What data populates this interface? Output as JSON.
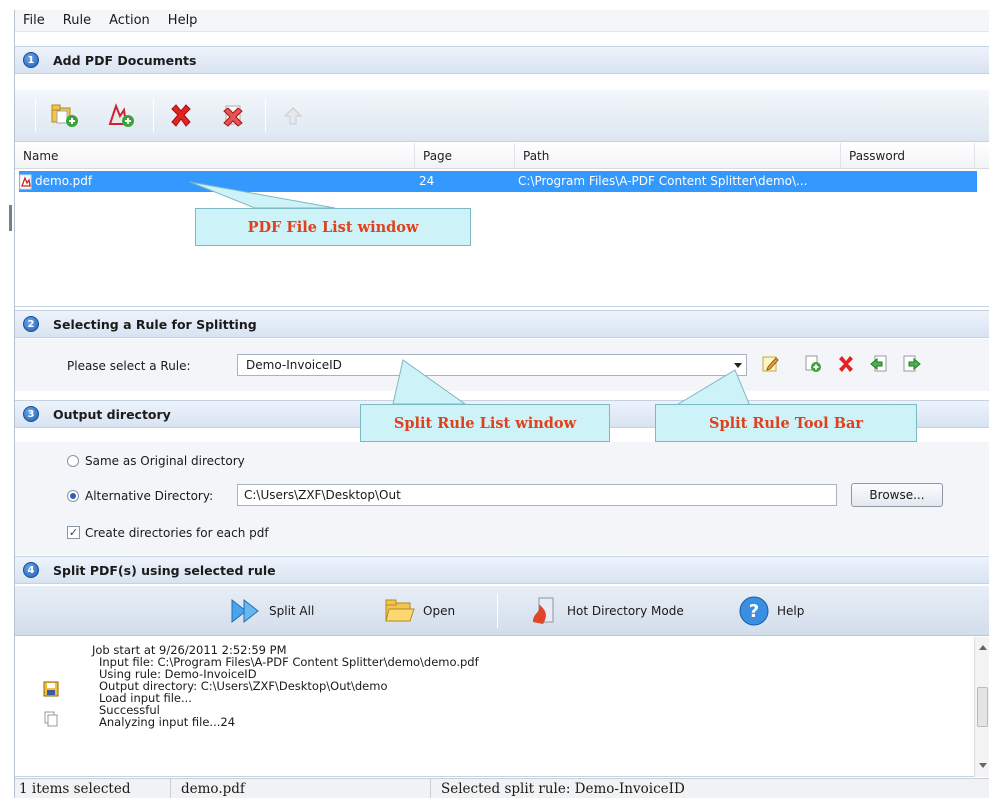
{
  "menu": [
    "File",
    "Rule",
    "Action",
    "Help"
  ],
  "sections": [
    {
      "num": "1",
      "title": "Add PDF Documents"
    },
    {
      "num": "2",
      "title": "Selecting a Rule for Splitting"
    },
    {
      "num": "3",
      "title": "Output directory"
    },
    {
      "num": "4",
      "title": "Split PDF(s) using selected rule"
    }
  ],
  "toolbar": {
    "buttons": [
      "add-folder-icon",
      "add-pdf-icon",
      "remove-icon",
      "remove-all-icon",
      "move-up-icon"
    ]
  },
  "file_list": {
    "columns": [
      "Name",
      "Page",
      "Path",
      "Password"
    ],
    "rows": [
      {
        "name": "demo.pdf",
        "page": "24",
        "path": "C:\\Program Files\\A-PDF Content Splitter\\demo\\...",
        "password": ""
      }
    ]
  },
  "callouts": {
    "file_list": "PDF File List window",
    "rule_list": "Split Rule List window",
    "rule_toolbar": "Split Rule Tool Bar"
  },
  "rule": {
    "label": "Please select a Rule:",
    "selected": "Demo-InvoiceID"
  },
  "output": {
    "same_label": "Same as Original directory",
    "alt_label": "Alternative Directory:",
    "alt_path": "C:\\Users\\ZXF\\Desktop\\Out",
    "browse": "Browse...",
    "create_dirs": "Create directories for each pdf"
  },
  "actions": {
    "split_all": "Split All",
    "open": "Open",
    "hot_dir": "Hot Directory Mode",
    "help": "Help"
  },
  "log": [
    "Job start at 9/26/2011 2:52:59 PM",
    "Input file: C:\\Program Files\\A-PDF Content Splitter\\demo\\demo.pdf",
    "Using rule: Demo-InvoiceID",
    "Output directory: C:\\Users\\ZXF\\Desktop\\Out\\demo",
    "Load input file...",
    "Successful",
    "Analyzing input file...24"
  ],
  "status": {
    "selected": "1 items selected",
    "file": "demo.pdf",
    "rule": "Selected split rule: Demo-InvoiceID"
  },
  "colors": {
    "selection": "#3399ff",
    "callout_bg": "#cdf2f7",
    "callout_text": "#e0401b",
    "section_gradient_top": "#eef3fb"
  }
}
